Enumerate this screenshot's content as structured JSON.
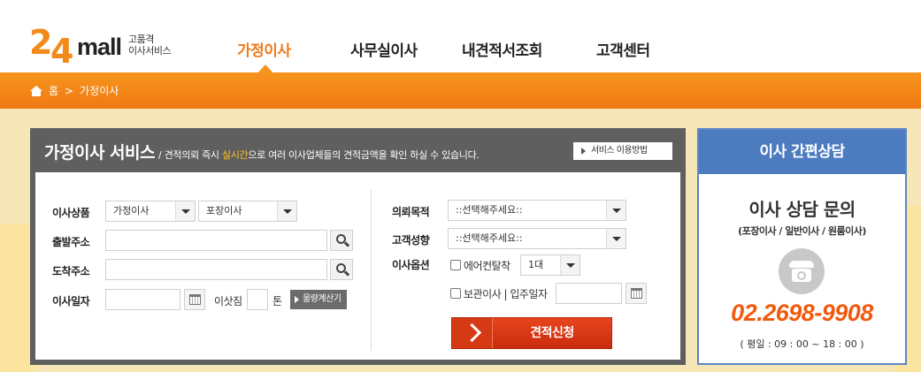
{
  "logo": {
    "digit_2": "2",
    "digit_4": "4",
    "mall": "mall",
    "tag_line1": "고품격",
    "tag_line2": "이사서비스"
  },
  "nav": {
    "items": [
      {
        "label": "가정이사"
      },
      {
        "label": "사무실이사"
      },
      {
        "label": "내견적서조회"
      },
      {
        "label": "고객센터"
      }
    ],
    "active_color": "#ef7b1a"
  },
  "breadcrumb": {
    "home": "홈",
    "separator": ">",
    "current": "가정이사"
  },
  "service": {
    "title": "가정이사 서비스",
    "desc_prefix": "/ 견적의뢰 즉시 ",
    "desc_highlight": "실시간",
    "desc_suffix": "으로 여러 이사업체들의 견적금액을 확인 하실 수 있습니다.",
    "guide_button": "서비스 이용방법"
  },
  "form_left": {
    "product_label": "이사상품",
    "product_select_1": "가정이사",
    "product_select_2": "포장이사",
    "origin_label": "출발주소",
    "origin_value": "",
    "dest_label": "도착주소",
    "dest_value": "",
    "date_label": "이사일자",
    "date_value": "",
    "load_label": "이삿짐",
    "load_value": "",
    "load_unit": "톤",
    "calc_button": "물량계산기"
  },
  "form_right": {
    "purpose_label": "의뢰목적",
    "purpose_select": "::선택해주세요::",
    "tendency_label": "고객성향",
    "tendency_select": "::선택해주세요::",
    "options_label": "이사옵션",
    "aircon_label": "에어컨탈착",
    "aircon_qty": "1대",
    "storage_label": "보관이사 | 입주일자",
    "storage_date_value": "",
    "submit_label": "견적신청"
  },
  "consult": {
    "header": "이사 간편상담",
    "title": "이사 상담 문의",
    "subtitle": "(포장이사 / 일반이사 / 원룸이사)",
    "phone": "02.2698-9908",
    "hours": "( 평일 : 09 : 00 ~ 18 : 00 )"
  },
  "colors": {
    "brand_orange": "#f7941d",
    "panel_gray": "#5f5f5f",
    "consult_blue": "#4d7bc0",
    "submit_red": "#d63a14",
    "phone_orange": "#f15a0e",
    "background_cream": "#f6e6b8"
  },
  "icons": [
    "home-icon",
    "search-icon",
    "calendar-icon",
    "phone-icon",
    "triangle-right-icon",
    "chevron-right-icon",
    "chevron-down-icon"
  ]
}
